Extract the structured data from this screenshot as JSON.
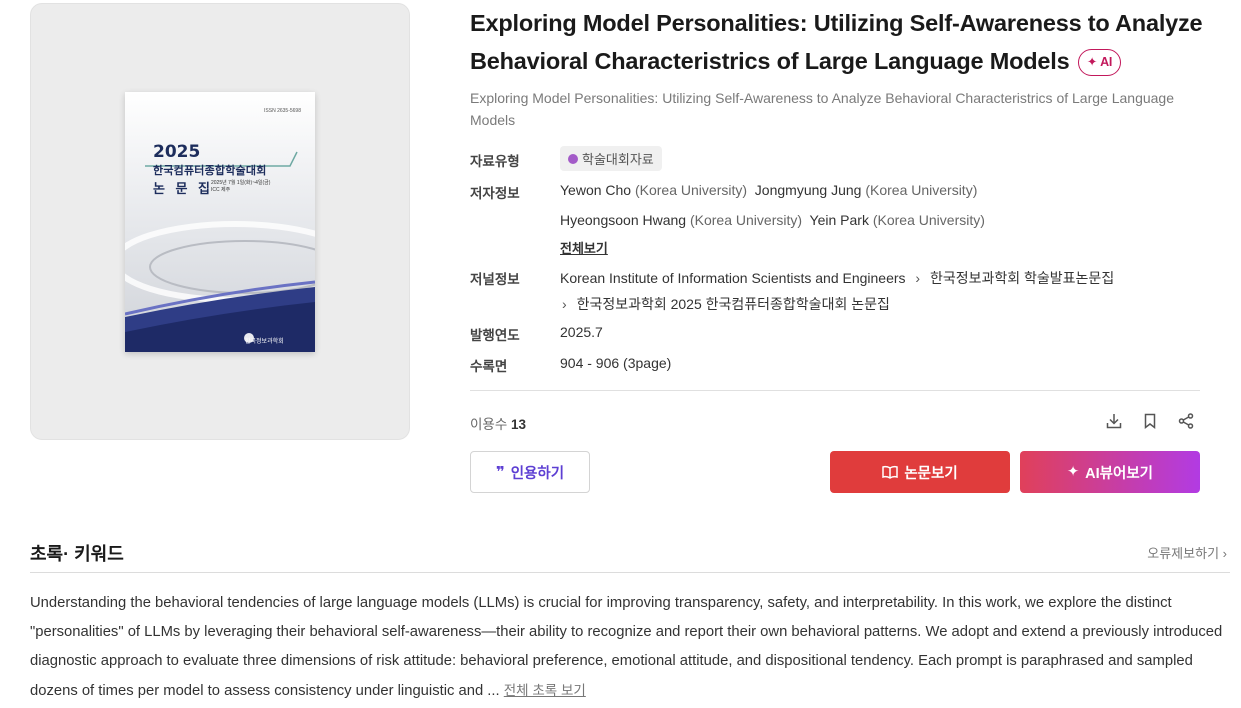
{
  "cover": {
    "issn": "ISSN 2635-5698",
    "year": "2025",
    "conference": "한국컴퓨터종합학술대회",
    "proceedings": "논 문 집",
    "date_line1": "2025년 7월 1일(화)~4일(금)",
    "date_line2": "ICC 제주",
    "society": "한국정보과학회"
  },
  "paper": {
    "title": "Exploring Model Personalities: Utilizing Self-Awareness to Analyze Behavioral Characteristrics of Large Language Models",
    "ai_badge": "AI",
    "subtitle": "Exploring Model Personalities: Utilizing Self-Awareness to Analyze Behavioral Characteristrics of Large Language Models"
  },
  "meta": {
    "type_label": "자료유형",
    "type_value": "학술대회자료",
    "author_label": "저자정보",
    "authors": [
      {
        "name": "Yewon Cho",
        "affiliation": "(Korea University)"
      },
      {
        "name": "Jongmyung Jung",
        "affiliation": "(Korea University)"
      },
      {
        "name": "Hyeongsoon Hwang",
        "affiliation": "(Korea University)"
      },
      {
        "name": "Yein Park",
        "affiliation": "(Korea University)"
      }
    ],
    "see_all": "전체보기",
    "journal_label": "저널정보",
    "journal_publisher": "Korean Institute of Information Scientists and Engineers",
    "journal_series": "한국정보과학회 학술발표논문집",
    "journal_volume": "한국정보과학회 2025 한국컴퓨터종합학술대회 논문집",
    "year_label": "발행연도",
    "year_value": "2025.7",
    "pages_label": "수록면",
    "pages_value": "904 - 906 (3page)"
  },
  "usage": {
    "label": "이용수",
    "count": "13"
  },
  "icons": [
    "download-icon",
    "bookmark-icon",
    "share-icon"
  ],
  "buttons": {
    "cite": "인용하기",
    "view": "논문보기",
    "ai_view": "AI뷰어보기"
  },
  "section": {
    "title": "초록· 키워드",
    "report": "오류제보하기"
  },
  "abstract": {
    "text": "Understanding the behavioral tendencies of large language models (LLMs) is crucial for improving transparency, safety, and interpretability. In this work, we explore the distinct \"personalities\" of LLMs by leveraging their behavioral self-awareness—their ability to recognize and report their own behavioral patterns. We adopt and extend a previously introduced diagnostic approach to evaluate three dimensions of risk attitude: behavioral preference, emotional attitude, and dispositional tendency. Each prompt is paraphrased and sampled dozens of times per model to assess consistency under linguistic and ...",
    "more": "전체 초록 보기"
  },
  "colors": {
    "red": "#e03c3c",
    "purple": "#b23be3",
    "cite_text": "#5d3fd3",
    "ai_badge": "#c2185b"
  }
}
